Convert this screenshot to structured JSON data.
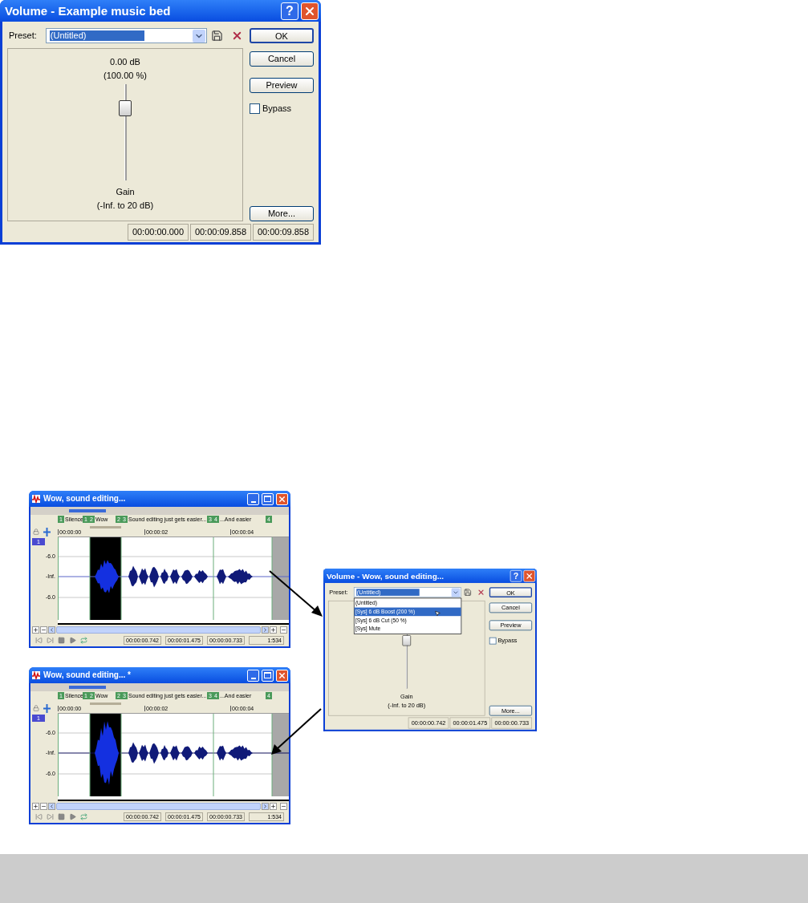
{
  "panels": [
    {
      "kind": "volume_dialog",
      "title": "Volume - Example music bed",
      "help_button": "?",
      "preset_label": "Preset:",
      "preset_value": "(Untitled)",
      "buttons": [
        "OK",
        "Cancel",
        "Preview"
      ],
      "bypass": {
        "label": "Bypass",
        "checked": false
      },
      "gain_reading": "0.00 dB",
      "gain_percent": "(100.00 %)",
      "slider": {
        "level": 0.8
      },
      "gain_label": "Gain",
      "gain_range": "(-Inf. to 20 dB)",
      "more_button": "More...",
      "status_bar": [
        "00:00:00.000",
        "00:00:09.858",
        "00:00:09.858"
      ]
    },
    {
      "kind": "editor_window",
      "title": "Wow, sound editing...",
      "boosted": false,
      "markers": [
        {
          "number": "1",
          "label": "Silence"
        },
        {
          "number": "1"
        },
        {
          "number": "2",
          "label": "Wow"
        },
        {
          "number": "2"
        },
        {
          "number": "3",
          "label": "Sound editing just gets easier..."
        },
        {
          "number": "3"
        },
        {
          "number": "4",
          "label": "...And easier"
        },
        {
          "number": "4"
        }
      ],
      "ruler": [
        "00:00:00",
        "00:00:02",
        "00:00:04"
      ],
      "channel": "1",
      "db_labels": [
        "-6.0",
        "-Inf.",
        "-6.0"
      ],
      "time_fields": [
        "00:00:00.742",
        "00:00:01.475",
        "00:00:00.733"
      ],
      "ratio": "1:534"
    },
    {
      "kind": "volume_dialog",
      "title": "Volume - Wow, sound editing...",
      "help_button": "?",
      "preset_label": "Preset:",
      "preset_value": "(Untitled)",
      "preset_list": [
        {
          "label": "(Untitled)",
          "selected": false
        },
        {
          "label": "[Sys] 6 dB Boost (200 %)",
          "selected": true
        },
        {
          "label": "[Sys] 6 dB Cut (50 %)",
          "selected": false
        },
        {
          "label": "[Sys] Mute",
          "selected": false
        }
      ],
      "buttons": [
        "OK",
        "Cancel",
        "Preview"
      ],
      "bypass": {
        "label": "Bypass",
        "checked": false
      },
      "slider": {
        "level": 0.8
      },
      "gain_label": "Gain",
      "gain_range": "(-Inf. to 20 dB)",
      "more_button": "More...",
      "status_bar": [
        "00:00:00.742",
        "00:00:01.475",
        "00:00:00.733"
      ]
    },
    {
      "kind": "editor_window",
      "title": "Wow, sound editing... *",
      "boosted": true,
      "markers": [
        {
          "number": "1",
          "label": "Silence"
        },
        {
          "number": "1"
        },
        {
          "number": "2",
          "label": "Wow"
        },
        {
          "number": "2"
        },
        {
          "number": "3",
          "label": "Sound editing just gets easier..."
        },
        {
          "number": "3"
        },
        {
          "number": "4",
          "label": "...And easier"
        },
        {
          "number": "4"
        }
      ],
      "ruler": [
        "00:00:00",
        "00:00:02",
        "00:00:04"
      ],
      "channel": "1",
      "db_labels": [
        "-6.0",
        "-Inf.",
        "-6.0"
      ],
      "time_fields": [
        "00:00:00.742",
        "00:00:01.475",
        "00:00:00.733"
      ],
      "ratio": "1:534"
    }
  ]
}
